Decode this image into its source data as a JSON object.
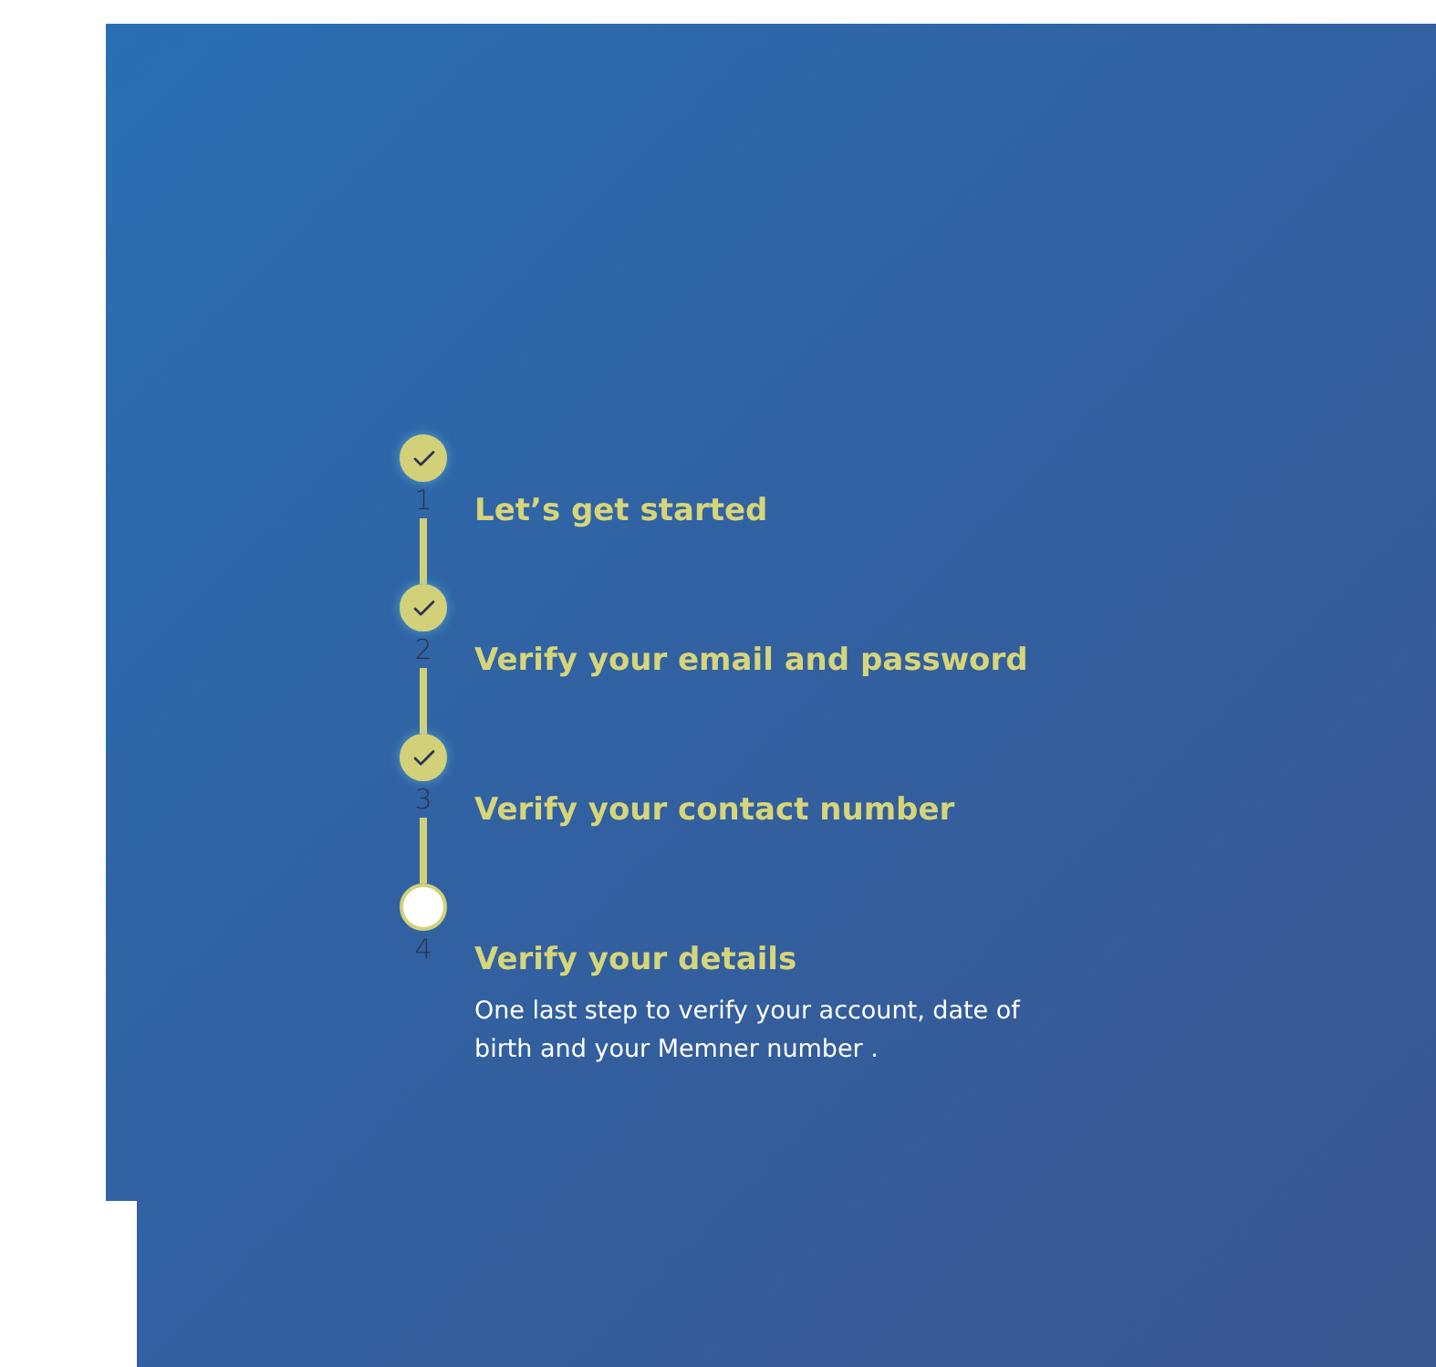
{
  "steps": [
    {
      "number": "1",
      "title": "Let’s get started",
      "completed": true
    },
    {
      "number": "2",
      "title": "Verify your email and password",
      "completed": true
    },
    {
      "number": "3",
      "title": "Verify your contact number",
      "completed": true
    },
    {
      "number": "4",
      "title": "Verify your details",
      "completed": false,
      "description": "One last step to verify your account, date of birth and your Memner number ."
    }
  ]
}
